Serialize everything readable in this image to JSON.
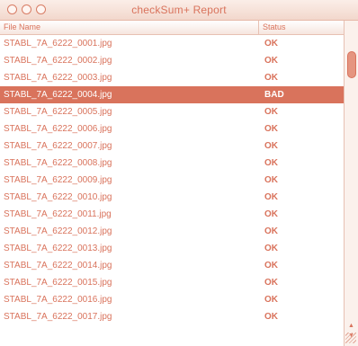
{
  "window": {
    "title": "checkSum+ Report"
  },
  "table": {
    "headers": {
      "file": "File Name",
      "status": "Status"
    },
    "rows": [
      {
        "file": "STABL_7A_6222_0001.jpg",
        "status": "OK"
      },
      {
        "file": "STABL_7A_6222_0002.jpg",
        "status": "OK"
      },
      {
        "file": "STABL_7A_6222_0003.jpg",
        "status": "OK"
      },
      {
        "file": "STABL_7A_6222_0004.jpg",
        "status": "BAD",
        "selected": true
      },
      {
        "file": "STABL_7A_6222_0005.jpg",
        "status": "OK"
      },
      {
        "file": "STABL_7A_6222_0006.jpg",
        "status": "OK"
      },
      {
        "file": "STABL_7A_6222_0007.jpg",
        "status": "OK"
      },
      {
        "file": "STABL_7A_6222_0008.jpg",
        "status": "OK"
      },
      {
        "file": "STABL_7A_6222_0009.jpg",
        "status": "OK"
      },
      {
        "file": "STABL_7A_6222_0010.jpg",
        "status": "OK"
      },
      {
        "file": "STABL_7A_6222_0011.jpg",
        "status": "OK"
      },
      {
        "file": "STABL_7A_6222_0012.jpg",
        "status": "OK"
      },
      {
        "file": "STABL_7A_6222_0013.jpg",
        "status": "OK"
      },
      {
        "file": "STABL_7A_6222_0014.jpg",
        "status": "OK"
      },
      {
        "file": "STABL_7A_6222_0015.jpg",
        "status": "OK"
      },
      {
        "file": "STABL_7A_6222_0016.jpg",
        "status": "OK"
      },
      {
        "file": "STABL_7A_6222_0017.jpg",
        "status": "OK"
      }
    ]
  },
  "colors": {
    "accent": "#d9735c",
    "selected_text": "#ffffff"
  },
  "icons": {
    "close": "close-icon",
    "minimize": "minimize-icon",
    "zoom": "zoom-icon",
    "scroll_up": "arrow-up-icon",
    "scroll_down": "arrow-down-icon",
    "resize": "resize-grip-icon"
  }
}
